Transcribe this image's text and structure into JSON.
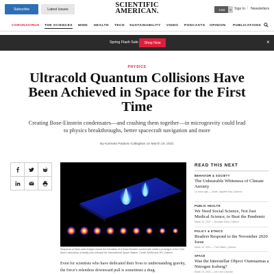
{
  "topbar": {
    "subscribe_label": "Subscribe",
    "latest_label": "Latest Issues",
    "logo_line1": "SCIENTIFIC",
    "logo_line2": "AMERICAN.",
    "cart_label": "Cart",
    "cart_count": "0",
    "signin_label": "Sign In",
    "separator": "|",
    "newsletters_label": "Newsletters"
  },
  "nav": {
    "items": [
      "CORONAVIRUS",
      "THE SCIENCES",
      "MIND",
      "HEALTH",
      "TECH",
      "SUSTAINABILITY",
      "VIDEO",
      "PODCASTS",
      "OPINION",
      "PUBLICATIONS"
    ],
    "search_icon": "search-icon"
  },
  "promo": {
    "text": "Spring Flash Sale",
    "button_label": "Shop Now",
    "close_glyph": "×"
  },
  "article": {
    "kicker": "PHYSICS",
    "headline": "Ultracold Quantum Collisions Have Been Achieved in Space for the First Time",
    "dek": "Creating Bose-Einstein condensates—and crashing them together—in microgravity could lead to physics breakthroughs, better spacecraft navigation and more",
    "byline": "By Karmela Padavic-Callaghan on March 19, 2021",
    "caption": "Sequence of false color images shows the formation of a Bose-Einstein condensate inside a prototype of the Cold Atom Laboratory, a facility now onboard the International Space Station. Credit: NASA and JPL-Caltech",
    "body": "Even for scientists who have dedicated their lives to understanding gravity, the force's relentless downward pull is sometimes a drag."
  },
  "share_icons": [
    "facebook-icon",
    "twitter-icon",
    "reddit-icon",
    "linkedin-icon",
    "email-icon",
    "print-icon"
  ],
  "sidebar": {
    "title": "READ THIS NEXT",
    "items": [
      {
        "category": "BEHAVIOR & SOCIETY",
        "headline": "The Unbearable Whiteness of Climate Anxiety",
        "meta": "13 hours ago — Sarah Jaquette Ray | Opinion"
      },
      {
        "category": "PUBLIC HEALTH",
        "headline": "We Need Social Science, Not Just Medical Science, to Beat the Pandemic",
        "meta": "March 10, 2021 — Nicholas Dirks | Opinion"
      },
      {
        "category": "POLICY & ETHICS",
        "headline": "Readers Respond to the November 2020 Issue",
        "meta": "March 10, 2021 — The Editors | Opinion"
      },
      {
        "category": "SPACE",
        "headline": "Was the Interstellar Object 'Oumuamua a Nitrogen Iceberg?",
        "meta": "March 19, 2021 — Avi Loeb | Opinion"
      }
    ]
  },
  "colors": {
    "accent_red": "#d4203a",
    "subscribe_blue": "#2c6fb7",
    "promo_bg": "#2b2b2b",
    "promo_button": "#e01e3c"
  }
}
